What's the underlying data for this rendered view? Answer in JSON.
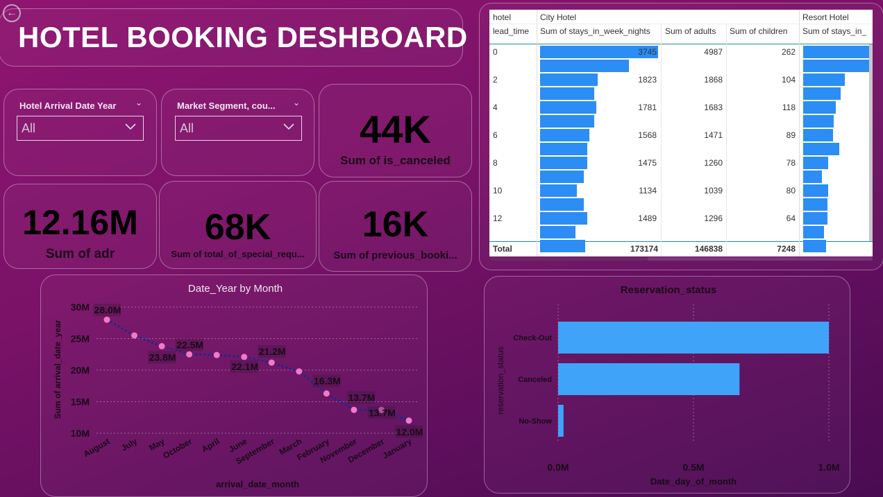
{
  "title": "HOTEL BOOKING DESHBOARD",
  "slicers": [
    {
      "label": "Hotel Arrival Date Year",
      "value": "All"
    },
    {
      "label": "Market Segment, cou...",
      "value": "All"
    }
  ],
  "kpis": {
    "canceled": {
      "value": "44K",
      "label": "Sum of is_canceled"
    },
    "adr": {
      "value": "12.16M",
      "label": "Sum of adr"
    },
    "special": {
      "value": "68K",
      "label": "Sum of total_of_special_requ..."
    },
    "previous": {
      "value": "16K",
      "label": "Sum of previous_booki..."
    }
  },
  "table": {
    "group_header": "hotel",
    "row_header": "lead_time",
    "group_city": "City Hotel",
    "group_resort": "Resort Hotel",
    "columns": [
      "Sum of stays_in_week_nights",
      "Sum of adults",
      "Sum of children",
      "Sum of stays_in_"
    ],
    "rows": [
      {
        "lead": "0",
        "stays": "3745",
        "adults": "4987",
        "children": "262",
        "bar": 1.0,
        "rbar": 1.0
      },
      {
        "lead": "",
        "stays": "",
        "adults": "",
        "children": "",
        "bar": 0.75,
        "rbar": 1.0
      },
      {
        "lead": "2",
        "stays": "1823",
        "adults": "1868",
        "children": "104",
        "bar": 0.49,
        "rbar": 0.62
      },
      {
        "lead": "",
        "stays": "",
        "adults": "",
        "children": "",
        "bar": 0.46,
        "rbar": 0.56
      },
      {
        "lead": "4",
        "stays": "1781",
        "adults": "1683",
        "children": "118",
        "bar": 0.475,
        "rbar": 0.49
      },
      {
        "lead": "",
        "stays": "",
        "adults": "",
        "children": "",
        "bar": 0.46,
        "rbar": 0.46
      },
      {
        "lead": "6",
        "stays": "1568",
        "adults": "1471",
        "children": "89",
        "bar": 0.42,
        "rbar": 0.45
      },
      {
        "lead": "",
        "stays": "",
        "adults": "",
        "children": "",
        "bar": 0.4,
        "rbar": 0.54
      },
      {
        "lead": "8",
        "stays": "1475",
        "adults": "1260",
        "children": "78",
        "bar": 0.4,
        "rbar": 0.37
      },
      {
        "lead": "",
        "stays": "",
        "adults": "",
        "children": "",
        "bar": 0.37,
        "rbar": 0.28
      },
      {
        "lead": "10",
        "stays": "1134",
        "adults": "1039",
        "children": "80",
        "bar": 0.31,
        "rbar": 0.38
      },
      {
        "lead": "",
        "stays": "",
        "adults": "",
        "children": "",
        "bar": 0.37,
        "rbar": 0.36
      },
      {
        "lead": "12",
        "stays": "1489",
        "adults": "1296",
        "children": "64",
        "bar": 0.4,
        "rbar": 0.36
      },
      {
        "lead": "",
        "stays": "",
        "adults": "",
        "children": "",
        "bar": 0.3,
        "rbar": 0.31
      },
      {
        "lead": "",
        "stays": "",
        "adults": "",
        "children": "",
        "bar": 0.38,
        "rbar": 0.34
      }
    ],
    "total": {
      "label": "Total",
      "stays": "173174",
      "adults": "146838",
      "children": "7248"
    }
  },
  "chart_data": [
    {
      "type": "line",
      "title": "Date_Year by Month",
      "xlabel": "arrival_date_month",
      "ylabel": "Sum of arrival_date_year",
      "categories": [
        "August",
        "July",
        "May",
        "October",
        "April",
        "June",
        "September",
        "March",
        "February",
        "November",
        "December",
        "January"
      ],
      "values": [
        28.0,
        25.5,
        23.8,
        22.5,
        22.4,
        22.1,
        21.2,
        19.8,
        16.3,
        13.7,
        13.7,
        12.0
      ],
      "labels": [
        "28.0M",
        "",
        "23.8M",
        "22.5M",
        "",
        "22.1M",
        "21.2M",
        "",
        "16.3M",
        "13.7M",
        "13.7M",
        "12.0M"
      ],
      "yticks": [
        "10M",
        "15M",
        "20M",
        "25M",
        "30M"
      ],
      "ylim": [
        10,
        30
      ],
      "units": "M",
      "color": "#1a2a8c",
      "marker_color": "#f07ac8"
    },
    {
      "type": "bar",
      "orientation": "horizontal",
      "title": "Reservation_status",
      "xlabel": "Date_day_of_month",
      "ylabel": "reservation_status",
      "categories": [
        "Check-Out",
        "Canceled",
        "No-Show"
      ],
      "values": [
        1.0,
        0.67,
        0.02
      ],
      "xticks": [
        "0.0M",
        "0.5M",
        "1.0M"
      ],
      "xlim": [
        0,
        1.0
      ],
      "units": "M",
      "color": "#3fa3fa"
    }
  ]
}
